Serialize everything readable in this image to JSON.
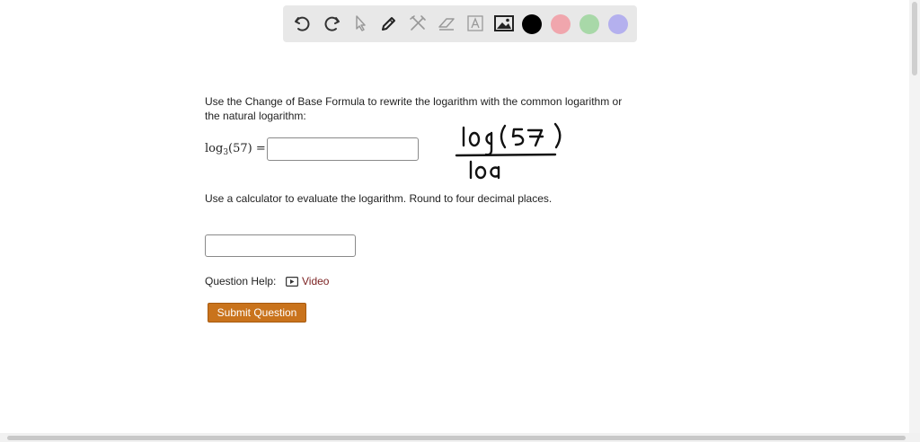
{
  "toolbar": {
    "tools": [
      "undo-icon",
      "redo-icon",
      "pointer-icon",
      "pen-icon",
      "tools-icon",
      "eraser-icon",
      "text-icon",
      "image-icon"
    ],
    "colors": [
      "#000000",
      "#f0a6ad",
      "#a8d8a8",
      "#b4b0ee"
    ]
  },
  "question": {
    "instruction1_line1": "Use the Change of Base Formula to rewrite the logarithm with the common logarithm or",
    "instruction1_line2": "the natural logarithm:",
    "expr_log": "log",
    "expr_base": "3",
    "expr_arg": "(57) =",
    "answer1_value": "",
    "instruction2": "Use a calculator to evaluate the logarithm. Round to four decimal places.",
    "answer2_value": "",
    "help_label": "Question Help:",
    "video_label": "Video",
    "submit_label": "Submit Question"
  },
  "handwriting": {
    "numerator": "log (57)",
    "denominator": "loa"
  }
}
